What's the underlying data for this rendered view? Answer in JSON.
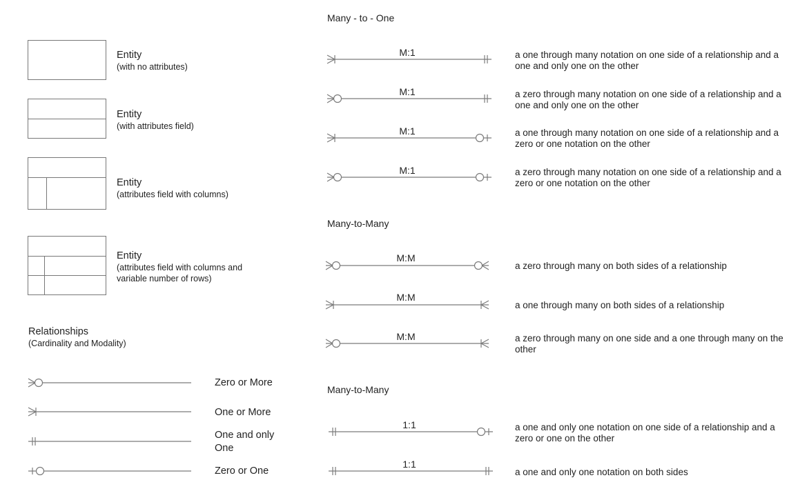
{
  "colors": {
    "line": "#7a7a7a",
    "text": "#222222",
    "background": "#ffffff"
  },
  "entities": [
    {
      "title": "Entity",
      "subtitle": "(with no attributes)"
    },
    {
      "title": "Entity",
      "subtitle": "(with attributes field)"
    },
    {
      "title": "Entity",
      "subtitle": "(attributes field with columns)"
    },
    {
      "title": "Entity",
      "subtitle": "(attributes field with columns and variable number of rows)"
    }
  ],
  "relationships": {
    "title": "Relationships",
    "subtitle": "(Cardinality and Modality)",
    "items": [
      {
        "label": "Zero or More",
        "symbol": "zero-or-more"
      },
      {
        "label": "One or More",
        "symbol": "one-or-more"
      },
      {
        "label": "One and only One",
        "symbol": "one-and-only-one"
      },
      {
        "label": "Zero or One",
        "symbol": "zero-or-one"
      }
    ]
  },
  "sections": [
    {
      "heading": "Many - to - One",
      "rows": [
        {
          "ratio": "M:1",
          "left": "one-or-more",
          "right": "one-and-only-one",
          "description": "a one through many notation on one side of a relationship and a one and only one on the other"
        },
        {
          "ratio": "M:1",
          "left": "zero-or-more",
          "right": "one-and-only-one",
          "description": "a zero through many notation on one side of a relationship and a one and only one on the other"
        },
        {
          "ratio": "M:1",
          "left": "one-or-more",
          "right": "zero-or-one",
          "description": "a one through many notation on one side of a relationship and a zero or one notation on the other"
        },
        {
          "ratio": "M:1",
          "left": "zero-or-more",
          "right": "zero-or-one",
          "description": "a zero through many notation on one side of a relationship and a zero or one notation on the other"
        }
      ]
    },
    {
      "heading": "Many-to-Many",
      "rows": [
        {
          "ratio": "M:M",
          "left": "zero-or-more",
          "right": "zero-or-more",
          "description": "a zero through many on both sides of a relationship"
        },
        {
          "ratio": "M:M",
          "left": "one-or-more",
          "right": "one-or-more",
          "description": "a one through many on both sides of a relationship"
        },
        {
          "ratio": "M:M",
          "left": "zero-or-more",
          "right": "one-or-more",
          "description": "a zero through many on one side and a one through many on the other"
        }
      ]
    },
    {
      "heading": "Many-to-Many",
      "rows": [
        {
          "ratio": "1:1",
          "left": "one-and-only-one",
          "right": "zero-or-one",
          "description": "a one and only one notation on one side of a relationship and a zero or one on the other"
        },
        {
          "ratio": "1:1",
          "left": "one-and-only-one",
          "right": "one-and-only-one",
          "description": "a one and only one notation on both sides"
        }
      ]
    }
  ]
}
